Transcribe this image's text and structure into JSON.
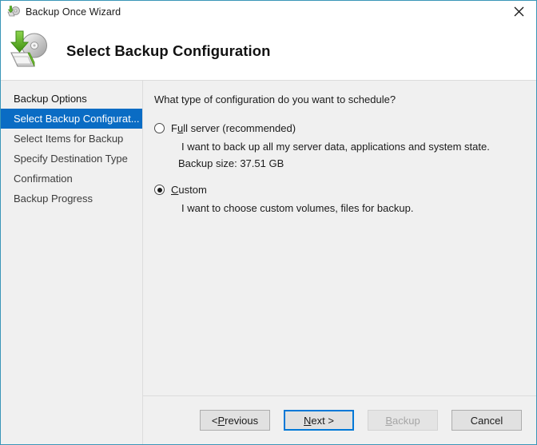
{
  "window": {
    "title": "Backup Once Wizard",
    "title_icon": "backup-disk-icon",
    "close_icon": "close-icon",
    "border_color": "#3a96b8"
  },
  "header": {
    "title": "Select Backup Configuration",
    "icon": "backup-disk-arrow-icon"
  },
  "sidebar": {
    "items": [
      {
        "label": "Backup Options",
        "selected": false,
        "emphasis": true
      },
      {
        "label": "Select Backup Configurat...",
        "selected": true,
        "emphasis": false
      },
      {
        "label": "Select Items for Backup",
        "selected": false,
        "emphasis": false
      },
      {
        "label": "Specify Destination Type",
        "selected": false,
        "emphasis": false
      },
      {
        "label": "Confirmation",
        "selected": false,
        "emphasis": false
      },
      {
        "label": "Backup Progress",
        "selected": false,
        "emphasis": false
      }
    ],
    "selected_background": "#0a6cc4"
  },
  "main": {
    "question": "What type of configuration do you want to schedule?",
    "options": [
      {
        "label_prefix": "F",
        "label_accel": "u",
        "label_rest": "ll server (recommended)",
        "label_full": "Full server (recommended)",
        "checked": false,
        "description": "I want to back up all my server data, applications and system state.",
        "detail": "Backup size: 37.51 GB"
      },
      {
        "label_prefix": "",
        "label_accel": "C",
        "label_rest": "ustom",
        "label_full": "Custom",
        "checked": true,
        "description": "I want to choose custom volumes, files for backup.",
        "detail": ""
      }
    ]
  },
  "footer": {
    "buttons": [
      {
        "name": "previous",
        "pre": "< ",
        "accel": "P",
        "post": "revious",
        "text": "< Previous",
        "state": "normal"
      },
      {
        "name": "next",
        "pre": "",
        "accel": "N",
        "post": "ext >",
        "text": "Next >",
        "state": "focused"
      },
      {
        "name": "backup",
        "pre": "",
        "accel": "B",
        "post": "ackup",
        "text": "Backup",
        "state": "disabled"
      },
      {
        "name": "cancel",
        "pre": "",
        "accel": "",
        "post": "Cancel",
        "text": "Cancel",
        "state": "normal"
      }
    ],
    "focus_color": "#0078d7"
  }
}
